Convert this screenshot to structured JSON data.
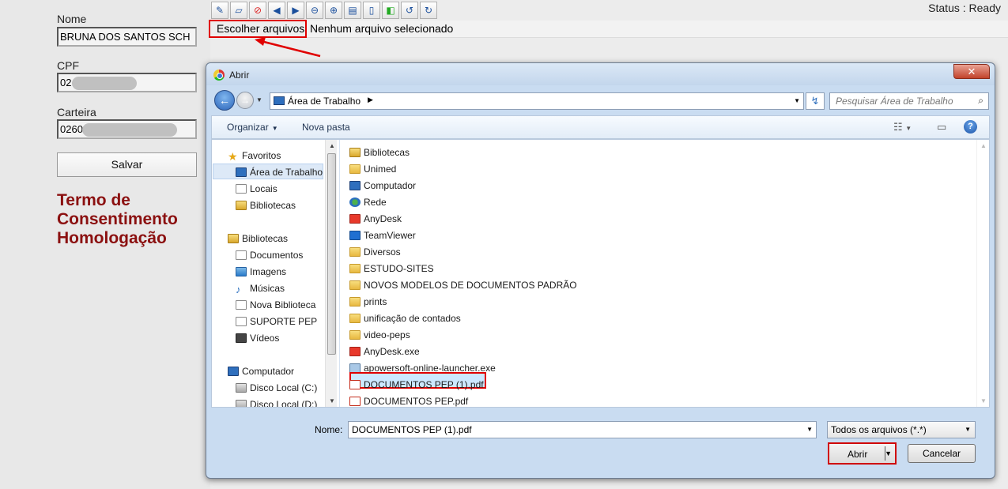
{
  "form": {
    "nome_label": "Nome",
    "nome_value": "BRUNA DOS SANTOS SCH",
    "cpf_label": "CPF",
    "cpf_value": "02",
    "carteira_label": "Carteira",
    "carteira_value": "0260",
    "save_label": "Salvar",
    "termo_title": "Termo de Consentimento Homologação"
  },
  "status": "Status : Ready",
  "upload": {
    "choose_label": "Escolher arquivos",
    "no_file_text": "Nenhum arquivo selecionado"
  },
  "dialog": {
    "title": "Abrir",
    "close_glyph": "✕",
    "path": "Área de Trabalho",
    "search_placeholder": "Pesquisar Área de Trabalho",
    "organize_label": "Organizar",
    "new_folder_label": "Nova pasta",
    "nav": [
      "Favoritos",
      "Área de Trabalho",
      "Locais",
      "Bibliotecas",
      "Bibliotecas",
      "Documentos",
      "Imagens",
      "Músicas",
      "Nova Biblioteca",
      "SUPORTE PEP",
      "Vídeos",
      "Computador",
      "Disco Local (C:)",
      "Disco Local (D:)"
    ],
    "files": [
      "Bibliotecas",
      "Unimed",
      "Computador",
      "Rede",
      "AnyDesk",
      "TeamViewer",
      "Diversos",
      "ESTUDO-SITES",
      "NOVOS MODELOS DE DOCUMENTOS PADRÃO",
      "prints",
      "unificação de contados",
      "video-peps",
      "AnyDesk.exe",
      "apowersoft-online-launcher.exe",
      "DOCUMENTOS PEP (1).pdf",
      "DOCUMENTOS PEP.pdf"
    ],
    "name_label": "Nome:",
    "name_value": "DOCUMENTOS PEP (1).pdf",
    "filetype": "Todos os arquivos (*.*)",
    "open_label": "Abrir",
    "cancel_label": "Cancelar"
  },
  "colors": {
    "accent_red": "#e00000",
    "termo_color": "#8b1010",
    "selection": "#cce8ff"
  }
}
